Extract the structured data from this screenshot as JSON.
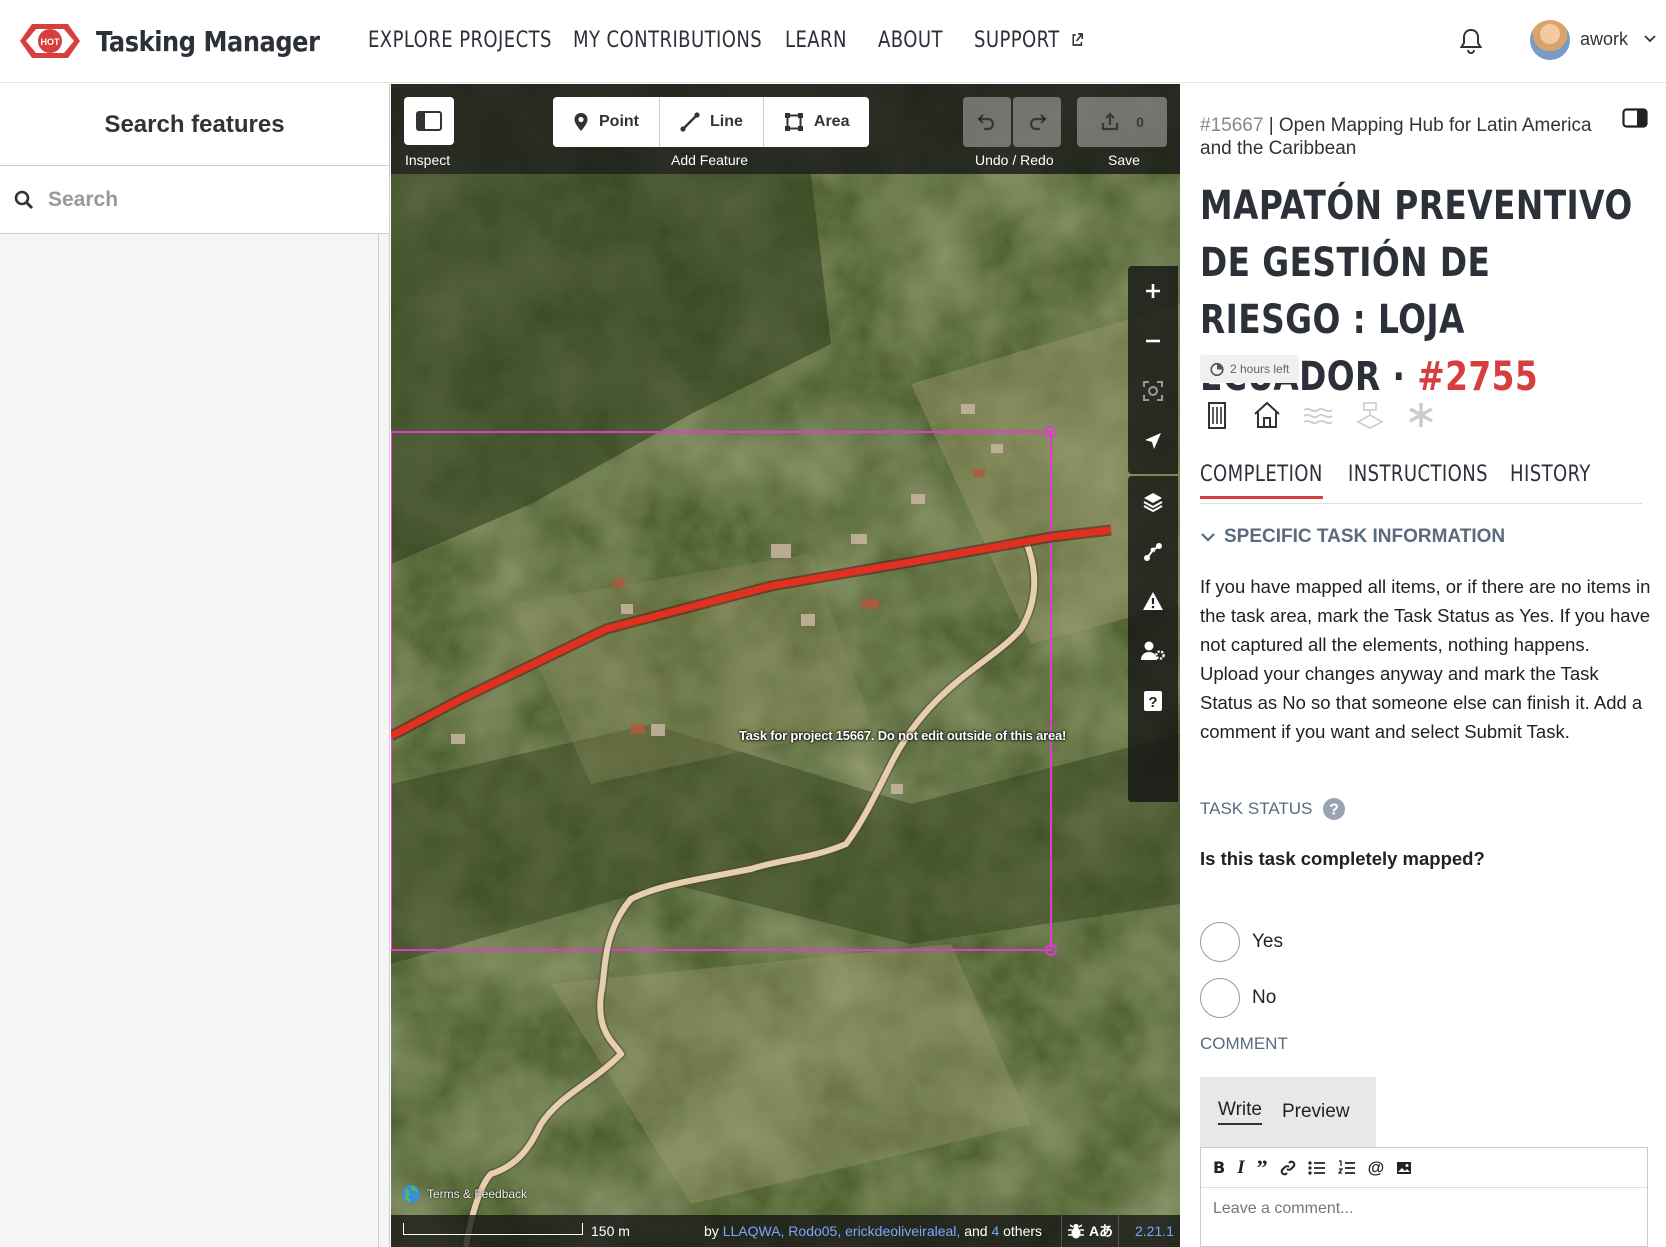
{
  "nav": {
    "logo_badge": "HOT",
    "app_name": "Tasking Manager",
    "links": [
      "EXPLORE PROJECTS",
      "MY CONTRIBUTIONS",
      "LEARN",
      "ABOUT",
      "SUPPORT"
    ],
    "username": "awork"
  },
  "left_panel": {
    "title": "Search features",
    "search_placeholder": "Search"
  },
  "map": {
    "toolbar": {
      "inspect_label": "Inspect",
      "point_label": "Point",
      "line_label": "Line",
      "area_label": "Area",
      "add_feature_label": "Add Feature",
      "undo_redo_label": "Undo / Redo",
      "save_label": "Save",
      "save_count": "0"
    },
    "task_note": "Task for project 15667. Do not edit outside of this area!",
    "terms_label": "Terms & Feedback",
    "scale_label": "150 m",
    "attribution": {
      "prefix": "by",
      "users": "LLAQWA, Rodo05, erickdeoliveiraleal,",
      "middle": "and",
      "others_count": "4",
      "suffix": "others"
    },
    "locale_glyph": "Aあ",
    "version": "2.21.1"
  },
  "right_panel": {
    "project_id": "#15667",
    "project_name": "| Open Mapping Hub for Latin America and the Caribbean",
    "task_title": "MAPATÓN PREVENTIVO DE GESTIÓN DE RIESGO : LOJA ECUADOR ·",
    "task_number": "#2755",
    "time_left": "2 hours left",
    "tabs": [
      "COMPLETION",
      "INSTRUCTIONS",
      "HISTORY"
    ],
    "specific_info_heading": "SPECIFIC TASK INFORMATION",
    "instructions_text": "If you have mapped all items, or if there are no items in the task area, mark the Task Status as Yes. If you have not captured all the elements, nothing happens. Upload your changes anyway and mark the Task Status as No so that someone else can finish it. Add a comment if you want and select Submit Task.",
    "task_status_label": "TASK STATUS",
    "question": "Is this task completely mapped?",
    "options": [
      "Yes",
      "No"
    ],
    "comment_label": "COMMENT",
    "comment_tabs": [
      "Write",
      "Preview"
    ],
    "comment_placeholder": "Leave a comment..."
  },
  "colors": {
    "accent_red": "#d73f3f",
    "task_boundary": "#e23ad1",
    "road_primary": "#e03020",
    "road_track": "#e6cfae"
  },
  "icons": [
    "hot-logo-icon",
    "external-link-icon",
    "bell-icon",
    "chevron-down-icon",
    "search-icon",
    "sidebar-toggle-icon",
    "point-icon",
    "line-icon",
    "area-icon",
    "undo-icon",
    "redo-icon",
    "upload-icon",
    "zoom-in-icon",
    "zoom-out-icon",
    "zoom-to-selection-icon",
    "geolocate-icon",
    "layers-icon",
    "map-data-icon",
    "issues-icon",
    "preferences-icon",
    "help-icon",
    "globe-icon",
    "bug-icon",
    "timer-icon",
    "buildings-icon",
    "house-icon",
    "waterways-icon",
    "landuse-icon",
    "asterisk-icon",
    "help-circle-icon",
    "panel-collapse-icon"
  ]
}
